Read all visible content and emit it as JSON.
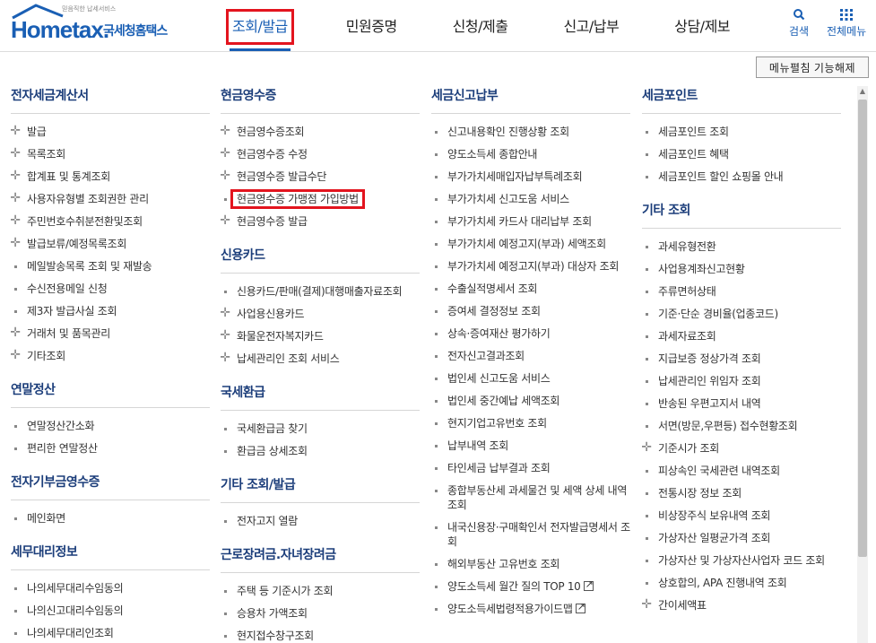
{
  "header": {
    "logo_tagline": "믿음직한 납세서비스",
    "logo_brand": "Hometax.",
    "logo_brand_kr": "국세청홈택스",
    "nav": [
      "조회/발급",
      "민원증명",
      "신청/제출",
      "신고/납부",
      "상담/제보"
    ],
    "active_nav_index": 0,
    "search_label": "검색",
    "all_menu_label": "전체메뉴",
    "search_icon": "search-icon",
    "all_menu_icon": "grid-icon"
  },
  "menu_toggle_label": "메뉴펼침 기능해제",
  "columns": [
    {
      "groups": [
        {
          "title": "전자세금계산서",
          "items": [
            {
              "label": "발급",
              "mark": "plus"
            },
            {
              "label": "목록조회",
              "mark": "plus"
            },
            {
              "label": "합계표 및 통계조회",
              "mark": "plus"
            },
            {
              "label": "사용자유형별 조회권한 관리",
              "mark": "plus"
            },
            {
              "label": "주민번호수취분전환및조회",
              "mark": "plus"
            },
            {
              "label": "발급보류/예정목록조회",
              "mark": "plus"
            },
            {
              "label": "메일발송목록 조회 및 재발송",
              "mark": "dot"
            },
            {
              "label": "수신전용메일 신청",
              "mark": "dot"
            },
            {
              "label": "제3자 발급사실 조회",
              "mark": "dot"
            },
            {
              "label": "거래처 및 품목관리",
              "mark": "plus"
            },
            {
              "label": "기타조회",
              "mark": "plus"
            }
          ]
        },
        {
          "title": "연말정산",
          "items": [
            {
              "label": "연말정산간소화",
              "mark": "dot"
            },
            {
              "label": "편리한 연말정산",
              "mark": "dot"
            }
          ]
        },
        {
          "title": "전자기부금영수증",
          "items": [
            {
              "label": "메인화면",
              "mark": "dot"
            }
          ]
        },
        {
          "title": "세무대리정보",
          "items": [
            {
              "label": "나의세무대리수임동의",
              "mark": "dot"
            },
            {
              "label": "나의신고대리수임동의",
              "mark": "dot"
            },
            {
              "label": "나의세무대리인조회",
              "mark": "dot"
            }
          ]
        }
      ]
    },
    {
      "groups": [
        {
          "title": "현금영수증",
          "items": [
            {
              "label": "현금영수증조회",
              "mark": "plus"
            },
            {
              "label": "현금영수증 수정",
              "mark": "plus"
            },
            {
              "label": "현금영수증 발급수단",
              "mark": "plus"
            },
            {
              "label": "현금영수증 가맹점 가입방법",
              "mark": "dot",
              "highlight": true
            },
            {
              "label": "현금영수증 발급",
              "mark": "plus"
            }
          ]
        },
        {
          "title": "신용카드",
          "items": [
            {
              "label": "신용카드/판매(결제)대행매출자료조회",
              "mark": "dot"
            },
            {
              "label": "사업용신용카드",
              "mark": "plus"
            },
            {
              "label": "화물운전자복지카드",
              "mark": "plus"
            },
            {
              "label": "납세관리인 조회 서비스",
              "mark": "plus"
            }
          ]
        },
        {
          "title": "국세환급",
          "items": [
            {
              "label": "국세환급금 찾기",
              "mark": "dot"
            },
            {
              "label": "환급금 상세조회",
              "mark": "dot"
            }
          ]
        },
        {
          "title": "기타 조회/발급",
          "items": [
            {
              "label": "전자고지 열람",
              "mark": "dot"
            }
          ]
        },
        {
          "title": "근로장려금.자녀장려금",
          "items": [
            {
              "label": "주택 등 기준시가 조회",
              "mark": "dot"
            },
            {
              "label": "승용차 가액조회",
              "mark": "dot"
            },
            {
              "label": "현지접수창구조회",
              "mark": "dot"
            }
          ]
        }
      ]
    },
    {
      "groups": [
        {
          "title": "세금신고납부",
          "items": [
            {
              "label": "신고내용확인 진행상황 조회",
              "mark": "dot"
            },
            {
              "label": "양도소득세 종합안내",
              "mark": "dot"
            },
            {
              "label": "부가가치세매입자납부특례조회",
              "mark": "dot"
            },
            {
              "label": "부가가치세 신고도움 서비스",
              "mark": "dot"
            },
            {
              "label": "부가가치세 카드사 대리납부 조회",
              "mark": "dot"
            },
            {
              "label": "부가가치세 예정고지(부과) 세액조회",
              "mark": "dot"
            },
            {
              "label": "부가가치세 예정고지(부과) 대상자 조회",
              "mark": "dot"
            },
            {
              "label": "수출실적명세서 조회",
              "mark": "dot"
            },
            {
              "label": "증여세 결정정보 조회",
              "mark": "dot"
            },
            {
              "label": "상속·증여재산 평가하기",
              "mark": "dot"
            },
            {
              "label": "전자신고결과조회",
              "mark": "dot"
            },
            {
              "label": "법인세 신고도움 서비스",
              "mark": "dot"
            },
            {
              "label": "법인세 중간예납 세액조회",
              "mark": "dot"
            },
            {
              "label": "현지기업고유번호 조회",
              "mark": "dot"
            },
            {
              "label": "납부내역 조회",
              "mark": "dot"
            },
            {
              "label": "타인세금 납부결과 조회",
              "mark": "dot"
            },
            {
              "label": "종합부동산세 과세물건 및 세액 상세 내역 조회",
              "mark": "dot"
            },
            {
              "label": "내국신용장·구매확인서 전자발급명세서 조회",
              "mark": "dot"
            },
            {
              "label": "해외부동산 고유번호 조회",
              "mark": "dot"
            },
            {
              "label": "양도소득세 월간 질의 TOP 10",
              "mark": "dot",
              "external": true
            },
            {
              "label": "양도소득세법령적용가이드맵",
              "mark": "dot",
              "external": true
            }
          ]
        }
      ]
    },
    {
      "groups": [
        {
          "title": "세금포인트",
          "items": [
            {
              "label": "세금포인트 조회",
              "mark": "dot"
            },
            {
              "label": "세금포인트 혜택",
              "mark": "dot"
            },
            {
              "label": "세금포인트 할인 쇼핑몰 안내",
              "mark": "dot"
            }
          ]
        },
        {
          "title": "기타 조회",
          "items": [
            {
              "label": "과세유형전환",
              "mark": "dot"
            },
            {
              "label": "사업용계좌신고현황",
              "mark": "dot"
            },
            {
              "label": "주류면허상태",
              "mark": "dot"
            },
            {
              "label": "기준·단순 경비율(업종코드)",
              "mark": "dot"
            },
            {
              "label": "과세자료조회",
              "mark": "dot"
            },
            {
              "label": "지급보증 정상가격 조회",
              "mark": "dot"
            },
            {
              "label": "납세관리인 위임자 조회",
              "mark": "dot"
            },
            {
              "label": "반송된 우편고지서 내역",
              "mark": "dot"
            },
            {
              "label": "서면(방문,우편등) 접수현황조회",
              "mark": "dot"
            },
            {
              "label": "기준시가 조회",
              "mark": "plus"
            },
            {
              "label": "피상속인 국세관련 내역조회",
              "mark": "dot"
            },
            {
              "label": "전통시장 정보 조회",
              "mark": "dot"
            },
            {
              "label": "비상장주식 보유내역 조회",
              "mark": "dot"
            },
            {
              "label": "가상자산 일평균가격 조회",
              "mark": "dot"
            },
            {
              "label": "가상자산 및 가상자산사업자 코드 조회",
              "mark": "dot"
            },
            {
              "label": "상호합의, APA 진행내역 조회",
              "mark": "dot"
            },
            {
              "label": "간이세액표",
              "mark": "plus"
            }
          ]
        }
      ]
    }
  ]
}
